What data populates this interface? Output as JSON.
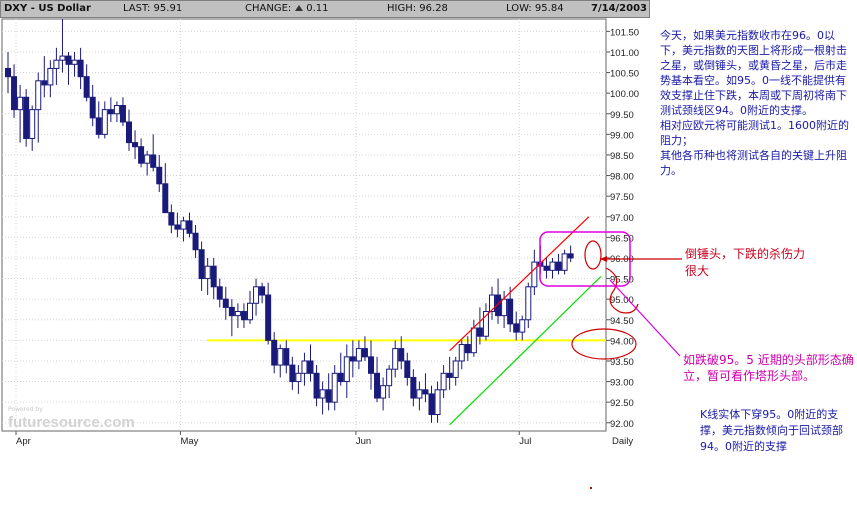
{
  "header": {
    "symbol": "DXY - US Dollar",
    "last": "LAST: 95.91",
    "change_label": "CHANGE:",
    "change_value": "0.11",
    "high": "HIGH: 96.28",
    "low": "LOW: 95.84",
    "date": "7/14/2003"
  },
  "watermark": {
    "powered": "Powered by",
    "brand": "futuresource.com"
  },
  "colors": {
    "header_bg": "#c0c0c0",
    "candle": "#1a1a7a",
    "support_line": "#ffff00",
    "channel_upper": "#ff0000",
    "channel_lower": "#00dd00",
    "annotation_red": "#cc0000",
    "annotation_magenta": "#dd00dd",
    "note_blue": "#1a1aa6",
    "note_red": "#c8001e",
    "note_magenta": "#cc00aa"
  },
  "annotations": {
    "main_note": "今天，如果美元指数收市在96。0以下，美元指数的天图上将形成一根射击之星，或倒锤头，或黄昏之星，后市走势基本看空。如95。0一线不能提供有效支撑止住下跌，本周或下周初将南下测试颈线区94。0附近的支撑。\n相对应欧元将可能测试1。1600附近的阻力；\n其他各币种也将测试各自的关键上升阻力。",
    "hammer_note": "倒锤头，下跌的杀伤力很大",
    "break_note": "如跌破95。5  近期的头部形态确立，暂可看作塔形头部。",
    "k_note": "K线实体下穿95。0附近的支撑，美元指数倾向于回试颈部94。0附近的支撑"
  },
  "chart_data": {
    "type": "candlestick",
    "title": "DXY - US Dollar",
    "period": "Daily",
    "x_tick_labels": [
      "Apr",
      "May",
      "Jun",
      "Jul",
      "Daily"
    ],
    "y_tick_labels": [
      "101.50",
      "101.00",
      "100.50",
      "100.00",
      "99.50",
      "99.00",
      "98.50",
      "98.00",
      "97.50",
      "97.00",
      "96.50",
      "96.00",
      "95.50",
      "95.00",
      "94.50",
      "94.00",
      "93.50",
      "93.00",
      "92.50",
      "92.00"
    ],
    "ylim": [
      91.8,
      101.8
    ],
    "y_axis_side": "right",
    "grid": true,
    "support_level": 94.0,
    "channel_upper": {
      "start": {
        "index": 73,
        "value": 93.75
      },
      "end": {
        "index": 96,
        "value": 97.0
      }
    },
    "channel_lower": {
      "start": {
        "index": 73,
        "value": 91.95
      },
      "end": {
        "index": 98,
        "value": 95.55
      }
    },
    "candles": [
      {
        "o": 100.6,
        "h": 101.0,
        "l": 100.0,
        "c": 100.4
      },
      {
        "o": 100.4,
        "h": 100.7,
        "l": 99.4,
        "c": 99.6
      },
      {
        "o": 99.6,
        "h": 100.2,
        "l": 98.8,
        "c": 99.9
      },
      {
        "o": 99.9,
        "h": 100.1,
        "l": 98.7,
        "c": 98.9
      },
      {
        "o": 98.9,
        "h": 99.7,
        "l": 98.6,
        "c": 99.6
      },
      {
        "o": 99.6,
        "h": 100.5,
        "l": 98.8,
        "c": 100.3
      },
      {
        "o": 100.3,
        "h": 100.9,
        "l": 99.9,
        "c": 100.2
      },
      {
        "o": 100.2,
        "h": 100.8,
        "l": 99.9,
        "c": 100.6
      },
      {
        "o": 100.6,
        "h": 101.1,
        "l": 100.2,
        "c": 100.8
      },
      {
        "o": 100.8,
        "h": 101.8,
        "l": 100.5,
        "c": 100.9
      },
      {
        "o": 100.9,
        "h": 101.0,
        "l": 100.2,
        "c": 100.7
      },
      {
        "o": 100.7,
        "h": 101.0,
        "l": 100.4,
        "c": 100.8
      },
      {
        "o": 100.8,
        "h": 101.1,
        "l": 100.1,
        "c": 100.4
      },
      {
        "o": 100.4,
        "h": 100.7,
        "l": 99.8,
        "c": 99.9
      },
      {
        "o": 99.9,
        "h": 100.2,
        "l": 99.2,
        "c": 99.4
      },
      {
        "o": 99.4,
        "h": 99.8,
        "l": 98.9,
        "c": 99.0
      },
      {
        "o": 99.0,
        "h": 99.8,
        "l": 98.9,
        "c": 99.6
      },
      {
        "o": 99.6,
        "h": 99.9,
        "l": 99.3,
        "c": 99.5
      },
      {
        "o": 99.5,
        "h": 99.8,
        "l": 99.3,
        "c": 99.7
      },
      {
        "o": 99.7,
        "h": 99.9,
        "l": 99.2,
        "c": 99.3
      },
      {
        "o": 99.3,
        "h": 99.6,
        "l": 98.6,
        "c": 98.8
      },
      {
        "o": 98.8,
        "h": 99.1,
        "l": 98.4,
        "c": 98.7
      },
      {
        "o": 98.7,
        "h": 98.9,
        "l": 98.2,
        "c": 98.3
      },
      {
        "o": 98.3,
        "h": 98.6,
        "l": 98.0,
        "c": 98.5
      },
      {
        "o": 98.5,
        "h": 99.0,
        "l": 98.1,
        "c": 98.2
      },
      {
        "o": 98.2,
        "h": 98.5,
        "l": 97.6,
        "c": 97.8
      },
      {
        "o": 97.8,
        "h": 98.3,
        "l": 97.4,
        "c": 97.1
      },
      {
        "o": 97.1,
        "h": 97.3,
        "l": 96.6,
        "c": 96.8
      },
      {
        "o": 96.8,
        "h": 97.1,
        "l": 96.5,
        "c": 96.7
      },
      {
        "o": 96.7,
        "h": 97.0,
        "l": 96.4,
        "c": 96.9
      },
      {
        "o": 96.9,
        "h": 97.1,
        "l": 96.5,
        "c": 96.6
      },
      {
        "o": 96.6,
        "h": 96.8,
        "l": 96.0,
        "c": 96.2
      },
      {
        "o": 96.2,
        "h": 96.4,
        "l": 95.2,
        "c": 95.5
      },
      {
        "o": 95.5,
        "h": 96.0,
        "l": 95.1,
        "c": 95.8
      },
      {
        "o": 95.8,
        "h": 96.0,
        "l": 95.0,
        "c": 95.3
      },
      {
        "o": 95.3,
        "h": 95.5,
        "l": 94.8,
        "c": 95.0
      },
      {
        "o": 95.0,
        "h": 95.3,
        "l": 94.5,
        "c": 94.8
      },
      {
        "o": 94.8,
        "h": 95.0,
        "l": 94.1,
        "c": 94.6
      },
      {
        "o": 94.6,
        "h": 94.9,
        "l": 94.3,
        "c": 94.7
      },
      {
        "o": 94.7,
        "h": 94.9,
        "l": 94.3,
        "c": 94.5
      },
      {
        "o": 94.5,
        "h": 95.2,
        "l": 94.4,
        "c": 94.9
      },
      {
        "o": 94.9,
        "h": 95.5,
        "l": 94.6,
        "c": 95.3
      },
      {
        "o": 95.3,
        "h": 95.4,
        "l": 94.9,
        "c": 95.1
      },
      {
        "o": 95.1,
        "h": 95.4,
        "l": 93.9,
        "c": 94.0
      },
      {
        "o": 94.0,
        "h": 94.2,
        "l": 93.2,
        "c": 93.4
      },
      {
        "o": 93.4,
        "h": 93.9,
        "l": 93.1,
        "c": 93.8
      },
      {
        "o": 93.8,
        "h": 94.0,
        "l": 93.2,
        "c": 93.4
      },
      {
        "o": 93.4,
        "h": 93.6,
        "l": 92.8,
        "c": 93.0
      },
      {
        "o": 93.0,
        "h": 93.4,
        "l": 92.7,
        "c": 93.2
      },
      {
        "o": 93.2,
        "h": 93.7,
        "l": 92.9,
        "c": 93.5
      },
      {
        "o": 93.5,
        "h": 93.9,
        "l": 93.0,
        "c": 93.2
      },
      {
        "o": 93.2,
        "h": 93.4,
        "l": 92.4,
        "c": 92.6
      },
      {
        "o": 92.6,
        "h": 93.0,
        "l": 92.2,
        "c": 92.8
      },
      {
        "o": 92.8,
        "h": 93.2,
        "l": 92.3,
        "c": 92.5
      },
      {
        "o": 92.5,
        "h": 93.4,
        "l": 92.3,
        "c": 93.2
      },
      {
        "o": 93.2,
        "h": 93.7,
        "l": 92.9,
        "c": 93.0
      },
      {
        "o": 93.0,
        "h": 93.9,
        "l": 92.6,
        "c": 93.6
      },
      {
        "o": 93.6,
        "h": 94.0,
        "l": 93.1,
        "c": 93.5
      },
      {
        "o": 93.5,
        "h": 94.0,
        "l": 93.3,
        "c": 93.8
      },
      {
        "o": 93.8,
        "h": 94.1,
        "l": 93.5,
        "c": 93.6
      },
      {
        "o": 93.6,
        "h": 94.0,
        "l": 92.8,
        "c": 93.2
      },
      {
        "o": 93.2,
        "h": 93.6,
        "l": 92.5,
        "c": 92.6
      },
      {
        "o": 92.6,
        "h": 93.1,
        "l": 92.3,
        "c": 92.9
      },
      {
        "o": 92.9,
        "h": 93.4,
        "l": 92.6,
        "c": 93.3
      },
      {
        "o": 93.3,
        "h": 94.0,
        "l": 93.1,
        "c": 93.8
      },
      {
        "o": 93.8,
        "h": 94.1,
        "l": 93.3,
        "c": 93.5
      },
      {
        "o": 93.5,
        "h": 93.7,
        "l": 92.9,
        "c": 93.1
      },
      {
        "o": 93.1,
        "h": 93.3,
        "l": 92.4,
        "c": 92.6
      },
      {
        "o": 92.6,
        "h": 93.0,
        "l": 92.3,
        "c": 92.8
      },
      {
        "o": 92.8,
        "h": 93.2,
        "l": 92.5,
        "c": 92.7
      },
      {
        "o": 92.7,
        "h": 92.9,
        "l": 92.0,
        "c": 92.2
      },
      {
        "o": 92.2,
        "h": 93.0,
        "l": 92.0,
        "c": 92.8
      },
      {
        "o": 92.8,
        "h": 93.4,
        "l": 92.6,
        "c": 93.2
      },
      {
        "o": 93.2,
        "h": 93.6,
        "l": 92.8,
        "c": 93.1
      },
      {
        "o": 93.1,
        "h": 93.6,
        "l": 92.9,
        "c": 93.5
      },
      {
        "o": 93.5,
        "h": 94.0,
        "l": 93.3,
        "c": 93.9
      },
      {
        "o": 93.9,
        "h": 94.1,
        "l": 93.5,
        "c": 93.7
      },
      {
        "o": 93.7,
        "h": 94.5,
        "l": 93.6,
        "c": 94.3
      },
      {
        "o": 94.3,
        "h": 94.8,
        "l": 93.9,
        "c": 94.1
      },
      {
        "o": 94.1,
        "h": 94.9,
        "l": 94.0,
        "c": 94.7
      },
      {
        "o": 94.7,
        "h": 95.3,
        "l": 94.5,
        "c": 95.1
      },
      {
        "o": 95.1,
        "h": 95.5,
        "l": 94.4,
        "c": 94.6
      },
      {
        "o": 94.6,
        "h": 95.2,
        "l": 94.3,
        "c": 95.0
      },
      {
        "o": 95.0,
        "h": 95.3,
        "l": 94.2,
        "c": 94.4
      },
      {
        "o": 94.4,
        "h": 94.7,
        "l": 94.0,
        "c": 94.2
      },
      {
        "o": 94.2,
        "h": 94.6,
        "l": 94.0,
        "c": 94.5
      },
      {
        "o": 94.5,
        "h": 95.4,
        "l": 94.3,
        "c": 95.3
      },
      {
        "o": 95.3,
        "h": 96.2,
        "l": 95.1,
        "c": 95.9
      },
      {
        "o": 95.9,
        "h": 96.3,
        "l": 95.6,
        "c": 95.8
      },
      {
        "o": 95.8,
        "h": 96.0,
        "l": 95.5,
        "c": 95.7
      },
      {
        "o": 95.7,
        "h": 96.0,
        "l": 95.5,
        "c": 95.9
      },
      {
        "o": 95.9,
        "h": 96.1,
        "l": 95.6,
        "c": 95.7
      },
      {
        "o": 95.7,
        "h": 96.2,
        "l": 95.6,
        "c": 96.1
      },
      {
        "o": 96.1,
        "h": 96.3,
        "l": 95.9,
        "c": 96.0
      }
    ]
  }
}
